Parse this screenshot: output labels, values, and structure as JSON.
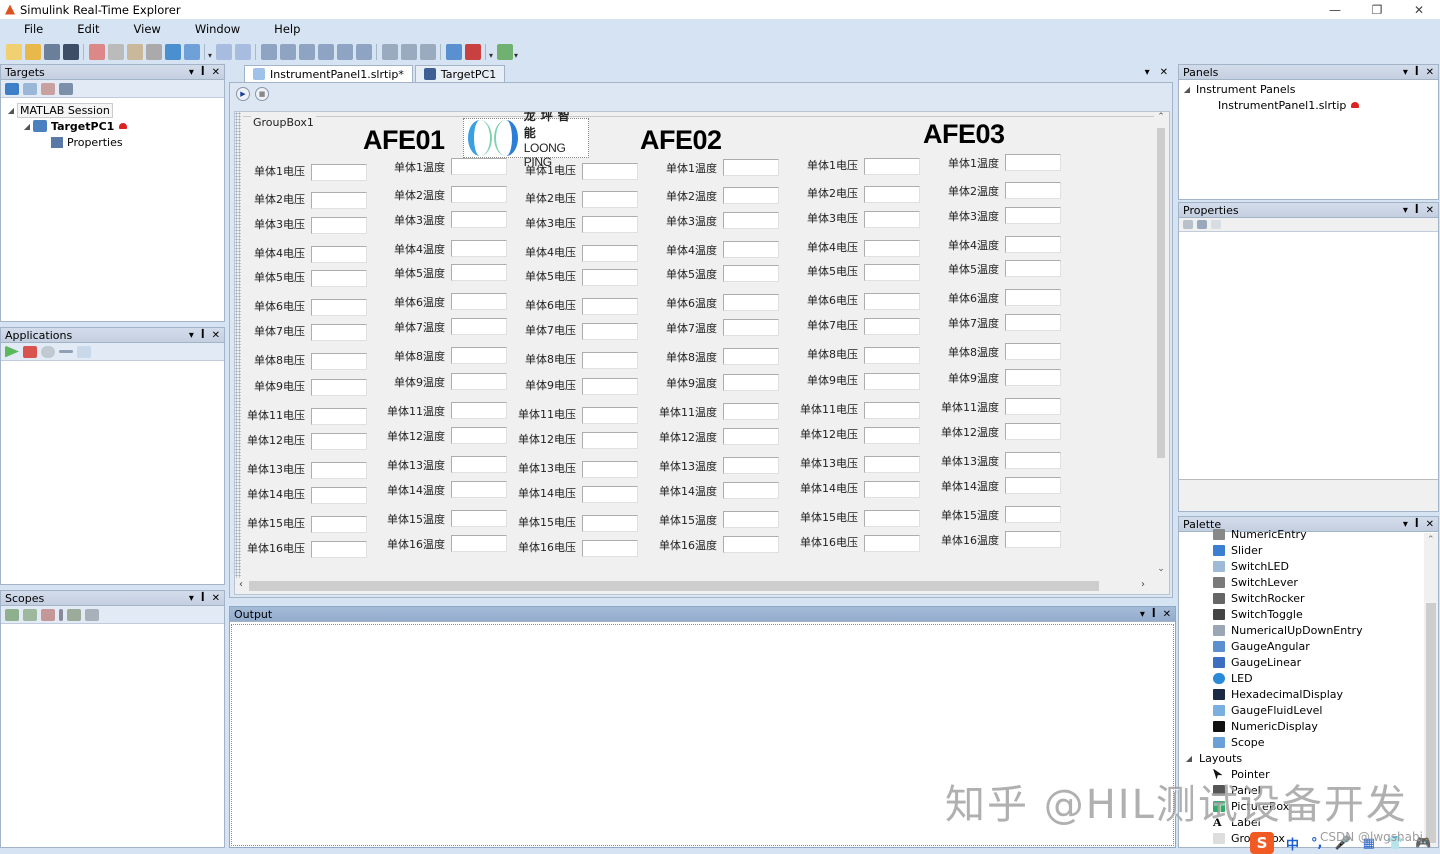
{
  "window": {
    "title": "Simulink Real-Time Explorer",
    "controls": {
      "minimize": "—",
      "restore": "❐",
      "close": "✕"
    }
  },
  "menu": [
    "File",
    "Edit",
    "View",
    "Window",
    "Help"
  ],
  "toolbar": {
    "icons": [
      "new-icon",
      "open-icon",
      "save-icon",
      "save-all-icon",
      "cut-icon",
      "copy-icon",
      "paste-icon",
      "delete-icon",
      "undo-icon",
      "redo-icon",
      "group-icon",
      "ungroup-icon",
      "align-bottom-icon",
      "align-top-icon",
      "align-left-icon",
      "align-right-icon",
      "align-center-icon",
      "align-middle-icon",
      "same-size-icon",
      "same-width-icon",
      "same-height-icon",
      "connect-target-icon",
      "disconnect-target-icon",
      "build-icon"
    ]
  },
  "targets_panel": {
    "title": "Targets",
    "tree": {
      "root": "MATLAB Session",
      "target": "TargetPC1",
      "child": "Properties"
    }
  },
  "applications_panel": {
    "title": "Applications"
  },
  "scopes_panel": {
    "title": "Scopes"
  },
  "document": {
    "tabs": [
      {
        "label": "InstrumentPanel1.slrtip*",
        "active": true
      },
      {
        "label": "TargetPC1",
        "active": false
      }
    ],
    "groupbox_label": "GroupBox1",
    "logo": {
      "cn": "龙坪智能",
      "en": "LOONG PING"
    },
    "afe_titles": [
      "AFE01",
      "AFE02",
      "AFE03"
    ],
    "cell_numbers": [
      1,
      2,
      3,
      4,
      5,
      6,
      7,
      8,
      9,
      11,
      12,
      13,
      14,
      15,
      16
    ],
    "label_prefix": "单体",
    "voltage_suffix": "电压",
    "temp_suffix": "温度"
  },
  "output_panel": {
    "title": "Output"
  },
  "panels_panel": {
    "title": "Panels",
    "tree": {
      "root": "Instrument Panels",
      "child": "InstrumentPanel1.slrtip"
    }
  },
  "properties_panel": {
    "title": "Properties"
  },
  "palette_panel": {
    "title": "Palette",
    "items": [
      {
        "label": "NumericEntry",
        "icon": "numeric-entry-icon",
        "color": "#888888"
      },
      {
        "label": "Slider",
        "icon": "slider-icon",
        "color": "#3c7fd0"
      },
      {
        "label": "SwitchLED",
        "icon": "switch-led-icon",
        "color": "#9fb9d9"
      },
      {
        "label": "SwitchLever",
        "icon": "switch-lever-icon",
        "color": "#7a7a7a"
      },
      {
        "label": "SwitchRocker",
        "icon": "switch-rocker-icon",
        "color": "#666666"
      },
      {
        "label": "SwitchToggle",
        "icon": "switch-toggle-icon",
        "color": "#444444"
      },
      {
        "label": "NumericalUpDownEntry",
        "icon": "updown-icon",
        "color": "#9aa6b5"
      },
      {
        "label": "GaugeAngular",
        "icon": "gauge-angular-icon",
        "color": "#5b8fd0"
      },
      {
        "label": "GaugeLinear",
        "icon": "gauge-linear-icon",
        "color": "#3c6fc0"
      },
      {
        "label": "LED",
        "icon": "led-icon",
        "color": "#2a8ad8"
      },
      {
        "label": "HexadecimalDisplay",
        "icon": "hex-display-icon",
        "color": "#1a2a44"
      },
      {
        "label": "GaugeFluidLevel",
        "icon": "fluid-level-icon",
        "color": "#7ab0e0"
      },
      {
        "label": "NumericDisplay",
        "icon": "numeric-display-icon",
        "color": "#111111"
      },
      {
        "label": "Scope",
        "icon": "scope-icon",
        "color": "#6aa0d8"
      }
    ],
    "layouts_group": "Layouts",
    "layouts": [
      {
        "label": "Pointer",
        "icon": "pointer-icon"
      },
      {
        "label": "Panel",
        "icon": "panel-icon"
      },
      {
        "label": "PictureBox",
        "icon": "picturebox-icon"
      },
      {
        "label": "Label",
        "icon": "label-icon"
      },
      {
        "label": "GroupBox",
        "icon": "groupbox-icon"
      }
    ]
  },
  "overlay": {
    "watermark": "知乎 @HIL测试设备开发",
    "csdn": "CSDN @lwgshabi",
    "ime": [
      "S",
      "中",
      "°,",
      "🎤",
      "▦",
      "👕",
      "🎮",
      "⊞",
      "⚙"
    ]
  }
}
